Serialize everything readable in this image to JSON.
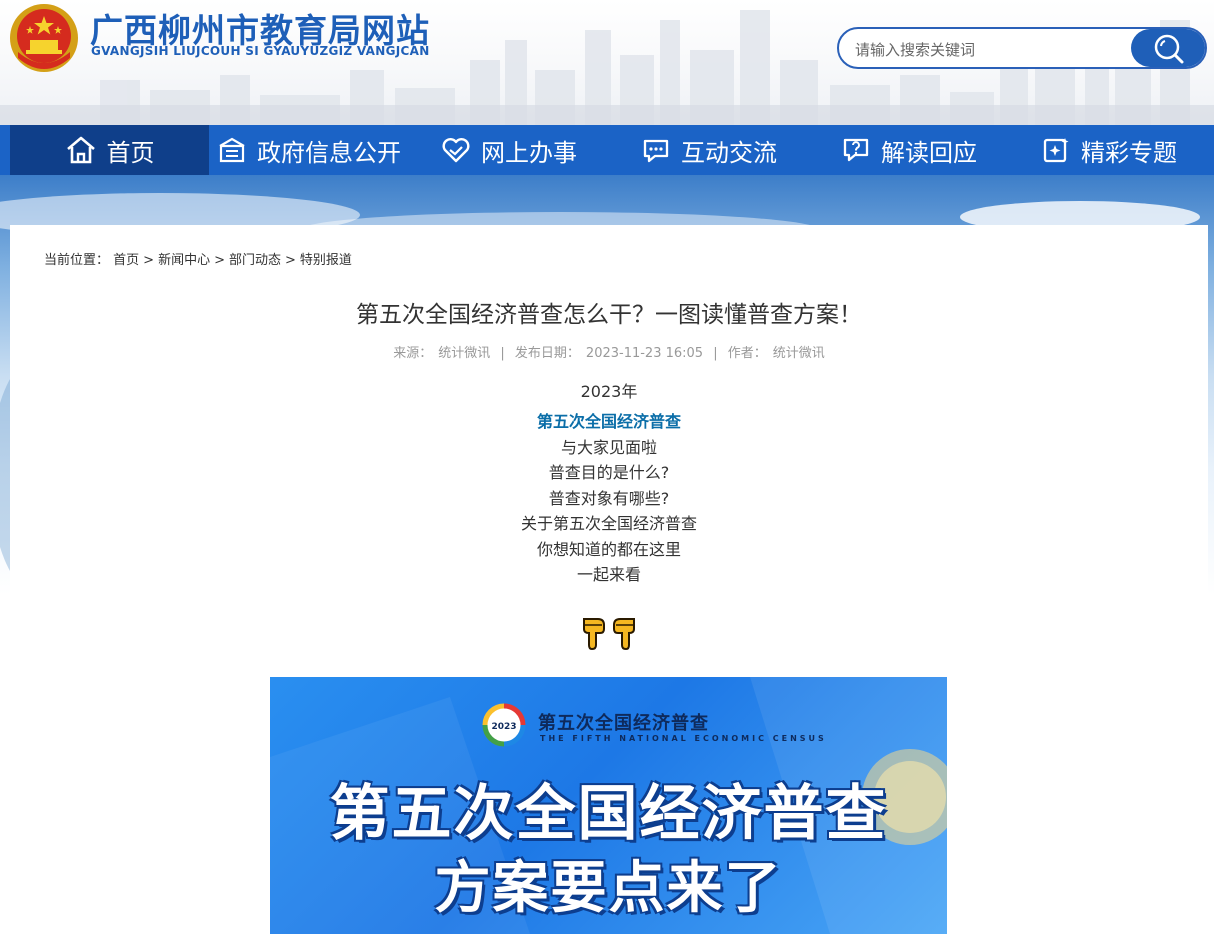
{
  "header": {
    "site_title": "广西柳州市教育局网站",
    "site_subtitle": "GVANGJSIH LIUJCOUH SI GYAUYUZGIZ VANGJCAN",
    "search": {
      "placeholder": "请输入搜索关键词",
      "value": ""
    }
  },
  "nav": {
    "items": [
      {
        "label": "首页",
        "icon": "home-icon",
        "active": true
      },
      {
        "label": "政府信息公开",
        "icon": "building-icon",
        "active": false
      },
      {
        "label": "网上办事",
        "icon": "handshake-heart-icon",
        "active": false
      },
      {
        "label": "互动交流",
        "icon": "chat-bubble-icon",
        "active": false
      },
      {
        "label": "解读回应",
        "icon": "question-bubble-icon",
        "active": false
      },
      {
        "label": "精彩专题",
        "icon": "sparkle-note-icon",
        "active": false
      }
    ]
  },
  "breadcrumb": {
    "prefix": "当前位置：",
    "items": [
      "首页",
      "新闻中心",
      "部门动态",
      "特别报道"
    ],
    "separator": ">"
  },
  "article": {
    "title": "第五次全国经济普查怎么干？一图读懂普查方案！",
    "meta": {
      "source_label": "来源：",
      "source": "统计微讯",
      "date_label": "发布日期：",
      "date": "2023-11-23 16:05",
      "author_label": "作者：",
      "author": "统计微讯",
      "divider": "|"
    },
    "lines": [
      "2023年",
      "第五次全国经济普查",
      "与大家见面啦",
      "普查目的是什么?",
      "普查对象有哪些?",
      "关于第五次全国经济普查",
      "你想知道的都在这里",
      "一起来看"
    ],
    "emoji": [
      "pointing-down-hand-icon",
      "pointing-down-hand-icon"
    ]
  },
  "poster": {
    "logo_text": "2023",
    "title_cn": "第五次全国经济普查",
    "title_en": "THE FIFTH NATIONAL ECONOMIC CENSUS",
    "headline_1": "第五次全国经济普查",
    "headline_2": "方案要点来了"
  },
  "colors": {
    "brand_blue": "#1e5fb8",
    "nav_bg": "#1b63c6",
    "nav_active": "#0f3f8a",
    "highlight_text": "#0b6ea8"
  }
}
